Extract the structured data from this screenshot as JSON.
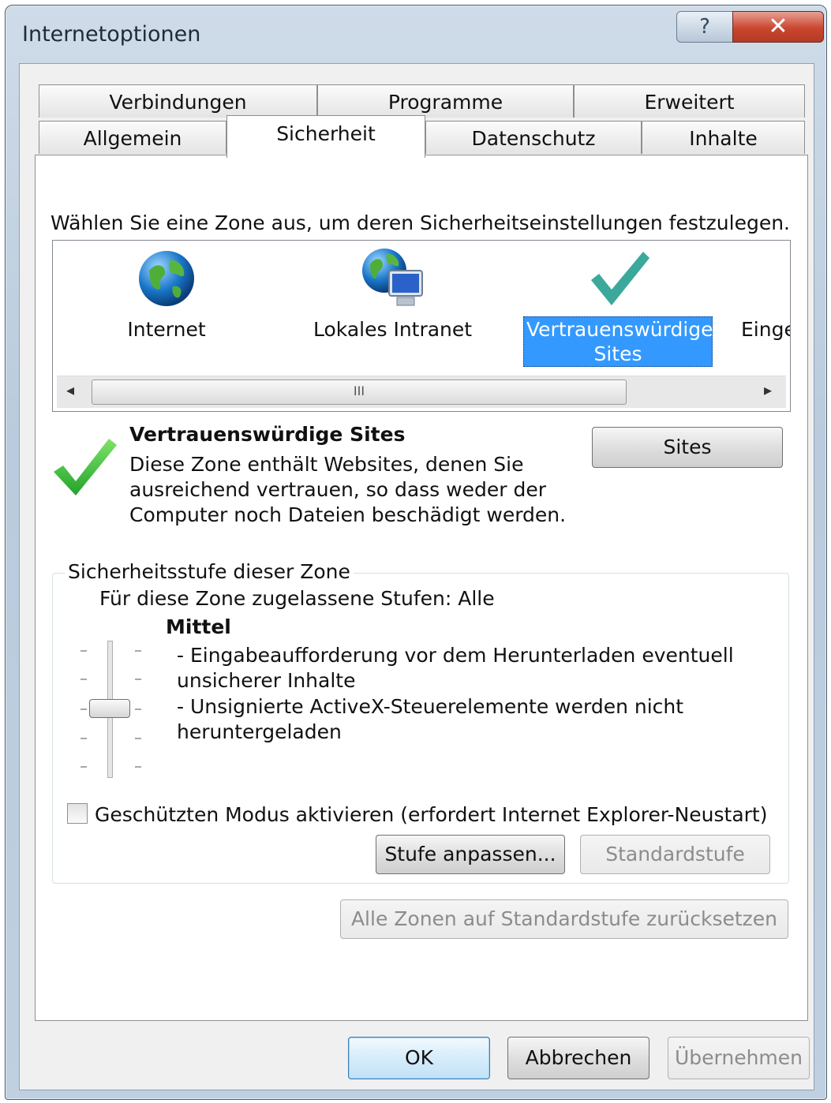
{
  "window": {
    "title": "Internetoptionen",
    "help_label": "?",
    "close_label": "✕"
  },
  "tabs": {
    "row1": [
      "Verbindungen",
      "Programme",
      "Erweitert"
    ],
    "row2": [
      "Allgemein",
      "Sicherheit",
      "Datenschutz",
      "Inhalte"
    ],
    "active": "Sicherheit"
  },
  "security": {
    "instruction": "Wählen Sie eine Zone aus, um deren Sicherheitseinstellungen festzulegen.",
    "zones": [
      {
        "label": "Internet",
        "icon": "globe-icon"
      },
      {
        "label": "Lokales Intranet",
        "icon": "intranet-icon"
      },
      {
        "label_line1": "Vertrauenswürdige",
        "label_line2": "Sites",
        "icon": "checkmark-icon",
        "selected": true
      },
      {
        "label": "Einge",
        "icon": "none"
      }
    ],
    "scroll_left": "◂",
    "scroll_right": "▸",
    "scroll_grip": "III",
    "zone_title": "Vertrauenswürdige Sites",
    "zone_desc": [
      "Diese Zone enthält Websites, denen Sie",
      "ausreichend vertrauen, so dass weder der",
      "Computer noch Dateien beschädigt werden."
    ],
    "sites_button": "Sites",
    "level_group_title": "Sicherheitsstufe dieser Zone",
    "allowed_levels": "Für diese Zone zugelassene Stufen: Alle",
    "level_name": "Mittel",
    "level_desc": [
      "- Eingabeaufforderung vor dem Herunterladen eventuell",
      "unsicherer Inhalte",
      "- Unsignierte ActiveX-Steuerelemente werden nicht",
      "heruntergeladen"
    ],
    "protected_mode": "Geschützten Modus aktivieren (erfordert Internet Explorer-Neustart)",
    "protected_mode_checked": false,
    "custom_level_button": "Stufe anpassen...",
    "default_level_button": "Standardstufe",
    "reset_all_button": "Alle Zonen auf Standardstufe zurücksetzen"
  },
  "footer": {
    "ok": "OK",
    "cancel": "Abbrechen",
    "apply": "Übernehmen"
  }
}
